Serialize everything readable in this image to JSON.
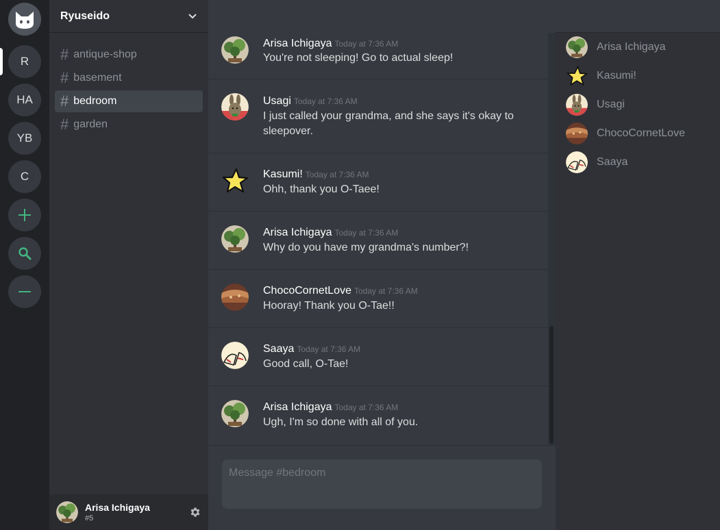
{
  "server": {
    "name": "Ryuseido"
  },
  "guilds": [
    {
      "label": "R"
    },
    {
      "label": "HA"
    },
    {
      "label": "YB"
    },
    {
      "label": "C"
    }
  ],
  "guild_icons": {
    "home": "cat-icon",
    "add": "plus-icon",
    "search": "search-icon",
    "leave": "minus-icon"
  },
  "channels": [
    {
      "name": "antique-shop"
    },
    {
      "name": "basement"
    },
    {
      "name": "bedroom"
    },
    {
      "name": "garden"
    }
  ],
  "current_channel": "bedroom",
  "user": {
    "name": "Arisa Ichigaya",
    "tag": "#5"
  },
  "messages": [
    {
      "author": "Arisa Ichigaya",
      "time": "Today at 7:36 AM",
      "text": "You're not sleeping! Go to actual sleep!",
      "avatar": "bonsai"
    },
    {
      "author": "Usagi",
      "time": "Today at 7:36 AM",
      "text": "I just called your grandma, and she says it's okay to sleepover.",
      "avatar": "rabbit"
    },
    {
      "author": "Kasumi!",
      "time": "Today at 7:36 AM",
      "text": "Ohh, thank you O-Taee!",
      "avatar": "star"
    },
    {
      "author": "Arisa Ichigaya",
      "time": "Today at 7:36 AM",
      "text": "Why do you have my grandma's number?!",
      "avatar": "bonsai"
    },
    {
      "author": "ChocoCornetLove",
      "time": "Today at 7:36 AM",
      "text": "Hooray! Thank you O-Tae!!",
      "avatar": "cornet"
    },
    {
      "author": "Saaya",
      "time": "Today at 7:36 AM",
      "text": "Good call, O-Tae!",
      "avatar": "bread"
    },
    {
      "author": "Arisa Ichigaya",
      "time": "Today at 7:36 AM",
      "text": "Ugh, I'm so done with all of you.",
      "avatar": "bonsai"
    }
  ],
  "composer": {
    "placeholder": "Message #bedroom"
  },
  "members": [
    {
      "name": "Arisa Ichigaya",
      "avatar": "bonsai"
    },
    {
      "name": "Kasumi!",
      "avatar": "star"
    },
    {
      "name": "Usagi",
      "avatar": "rabbit"
    },
    {
      "name": "ChocoCornetLove",
      "avatar": "cornet"
    },
    {
      "name": "Saaya",
      "avatar": "bread"
    }
  ],
  "colors": {
    "accent_green": "#43b581",
    "background": "#36393f",
    "sidebar": "#2f3136",
    "rail": "#202225"
  }
}
